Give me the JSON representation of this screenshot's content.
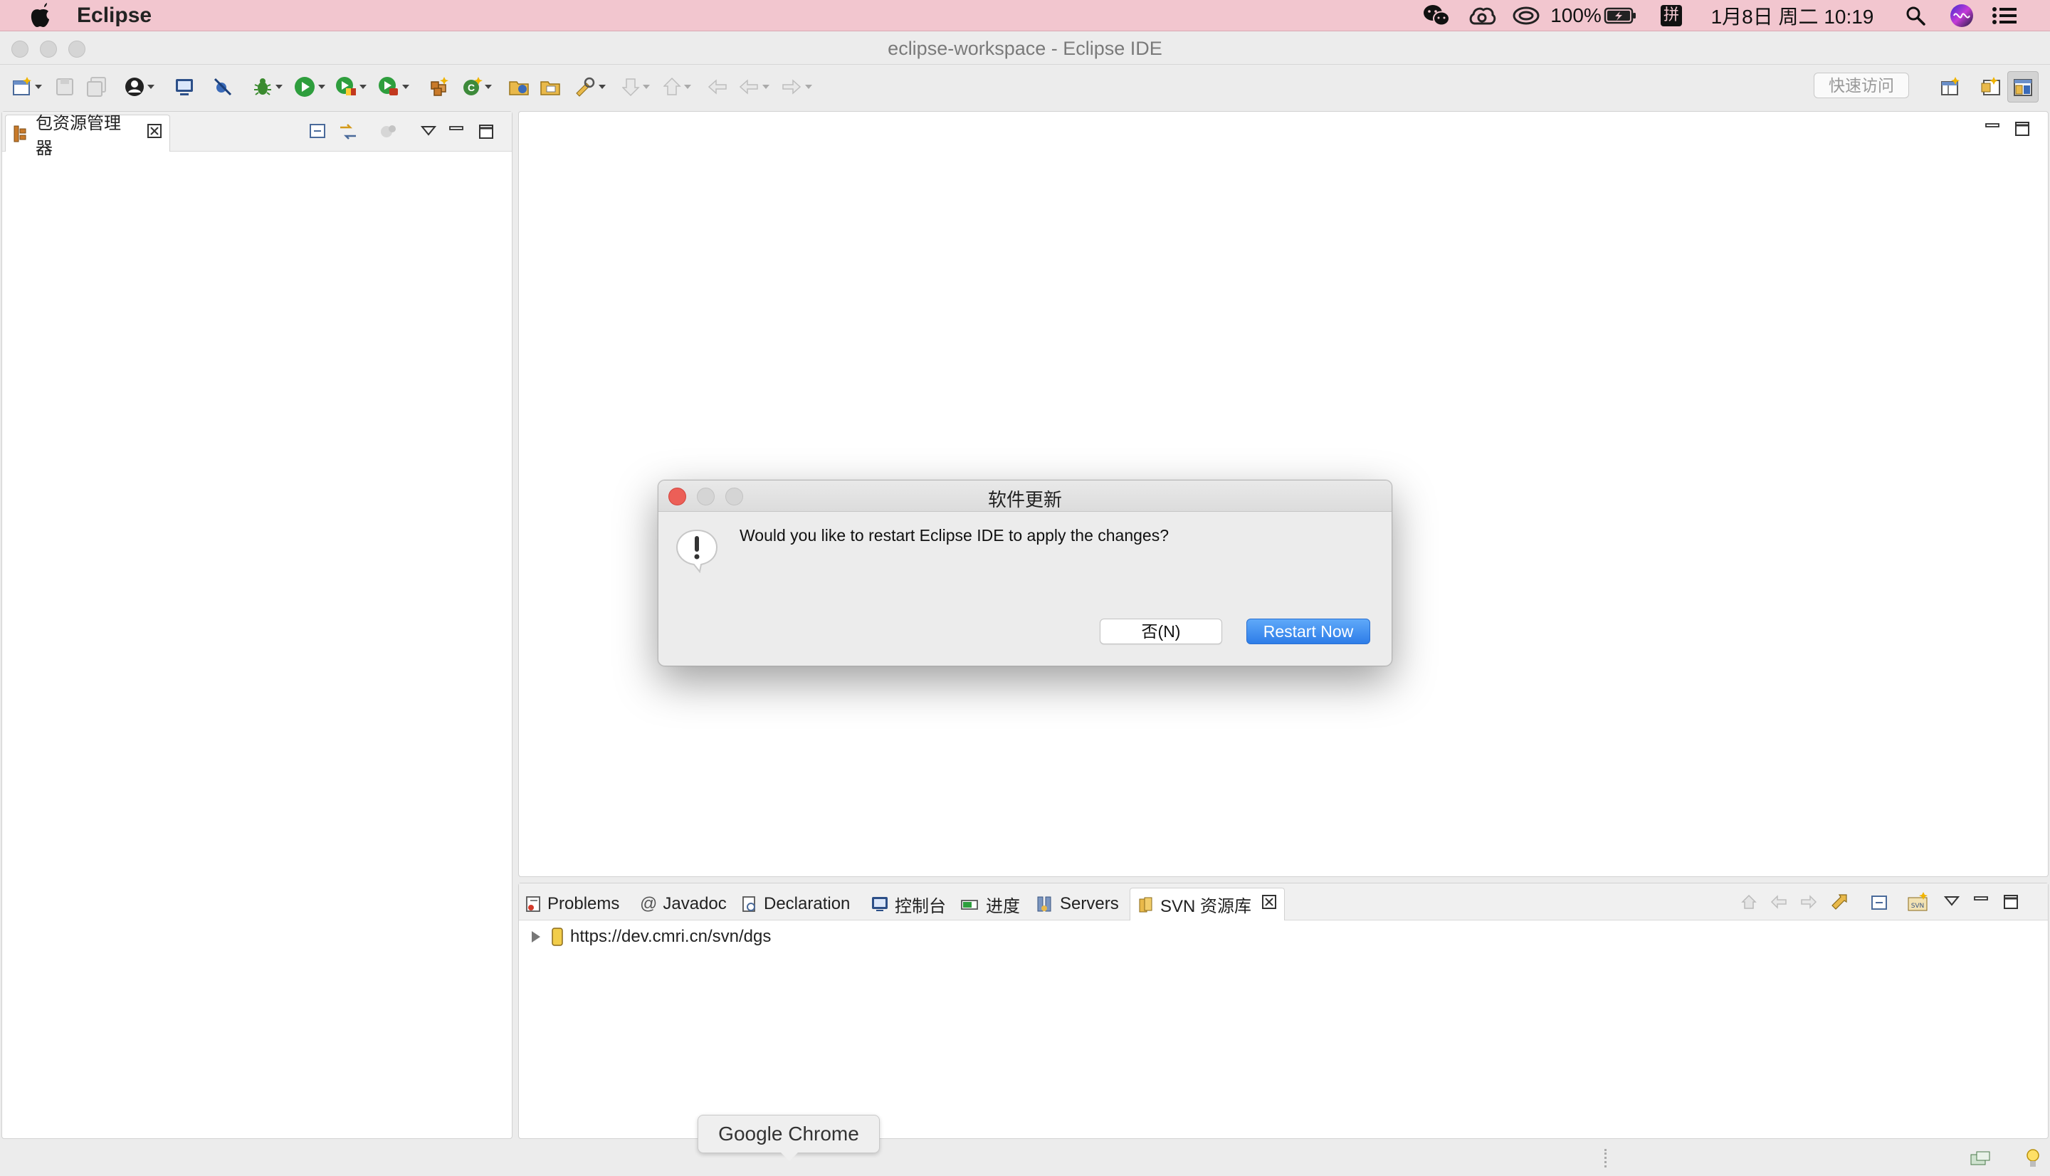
{
  "menubar": {
    "app_name": "Eclipse",
    "battery": "100%",
    "input_method": "拼",
    "datetime": "1月8日 周二 10:19"
  },
  "window": {
    "title": "eclipse-workspace - Eclipse IDE"
  },
  "toolbar": {
    "quick_access_placeholder": "快速访问"
  },
  "package_explorer": {
    "tab_label": "包资源管理器"
  },
  "bottom_panel": {
    "tabs": [
      {
        "label": "Problems"
      },
      {
        "label": "Javadoc"
      },
      {
        "label": "Declaration"
      },
      {
        "label": "控制台"
      },
      {
        "label": "进度"
      },
      {
        "label": "Servers"
      },
      {
        "label": "SVN 资源库"
      }
    ],
    "svn_repository_url": "https://dev.cmri.cn/svn/dgs"
  },
  "dialog": {
    "title": "软件更新",
    "message": "Would you like to restart Eclipse IDE to apply the changes?",
    "no_button": "否(N)",
    "restart_button": "Restart Now"
  },
  "dock_tooltip": "Google Chrome",
  "colors": {
    "menubar_bg": "#f2c6cf",
    "primary_button": "#2e7de8",
    "close_red": "#ec5f57",
    "run_green": "#2e9e3d",
    "debug_green": "#3a8a2e"
  },
  "icons": [
    "apple-icon",
    "wechat-icon",
    "creative-cloud-icon",
    "sync-icon",
    "battery-icon",
    "input-method-icon",
    "spotlight-search-icon",
    "siri-icon",
    "notification-list-icon",
    "new-wizard-icon",
    "save-icon",
    "save-all-icon",
    "profile-icon",
    "terminal-icon",
    "skip-breakpoints-icon",
    "debug-icon",
    "run-icon",
    "coverage-icon",
    "external-tools-icon",
    "new-java-package-icon",
    "new-java-class-icon",
    "open-type-icon",
    "open-task-icon",
    "search-icon",
    "next-annotation-icon",
    "previous-annotation-icon",
    "last-edit-icon",
    "back-icon",
    "forward-icon"
  ]
}
